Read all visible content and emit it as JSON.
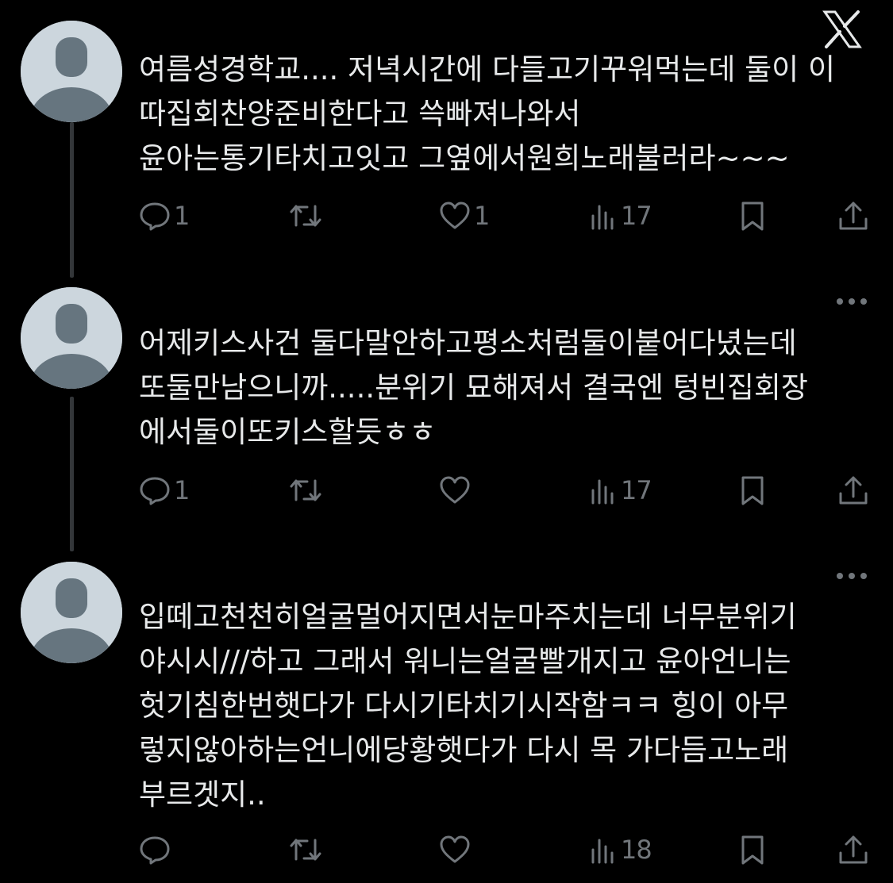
{
  "header": {
    "logo": "x-logo-icon"
  },
  "tweets": [
    {
      "avatar": "default-avatar",
      "lines": [
        "여름성경학교.... 저녁시간에 다들고기꾸워먹는데 둘이 이",
        "따집회찬양준비한다고 쓱빠져나와서",
        "윤아는통기타치고잇고 그옆에서원희노래불러라~~~"
      ],
      "replies": "1",
      "reposts": "",
      "likes": "1",
      "views": "17"
    },
    {
      "avatar": "default-avatar",
      "lines": [
        "어제키스사건 둘다말안하고평소처럼둘이붙어다녔는데",
        "또둘만남으니까.....분위기 묘해져서  결국엔 텅빈집회장",
        "에서둘이또키스할듯ㅎㅎ"
      ],
      "replies": "1",
      "reposts": "",
      "likes": "",
      "views": "17"
    },
    {
      "avatar": "default-avatar",
      "lines": [
        "입떼고천천히얼굴멀어지면서눈마주치는데 너무분위기",
        "야시시///하고 그래서 워니는얼굴빨개지고 윤아언니는",
        "헛기침한번햇다가 다시기타치기시작함ㅋㅋ 힝이 아무",
        "렇지않아하는언니에당황햇다가 다시 목 가다듬고노래",
        "부르겟지.."
      ],
      "replies": "",
      "reposts": "",
      "likes": "",
      "views": "18"
    }
  ],
  "icons": {
    "reply": "reply-icon",
    "repost": "repost-icon",
    "like": "like-icon",
    "views": "views-icon",
    "bookmark": "bookmark-icon",
    "share": "share-icon",
    "more": "more-icon"
  },
  "colors": {
    "background": "#000000",
    "text": "#e7e9ea",
    "muted": "#71767b",
    "thread_line": "#333639",
    "avatar_bg": "#ccd6dd",
    "avatar_fg": "#66757f"
  }
}
